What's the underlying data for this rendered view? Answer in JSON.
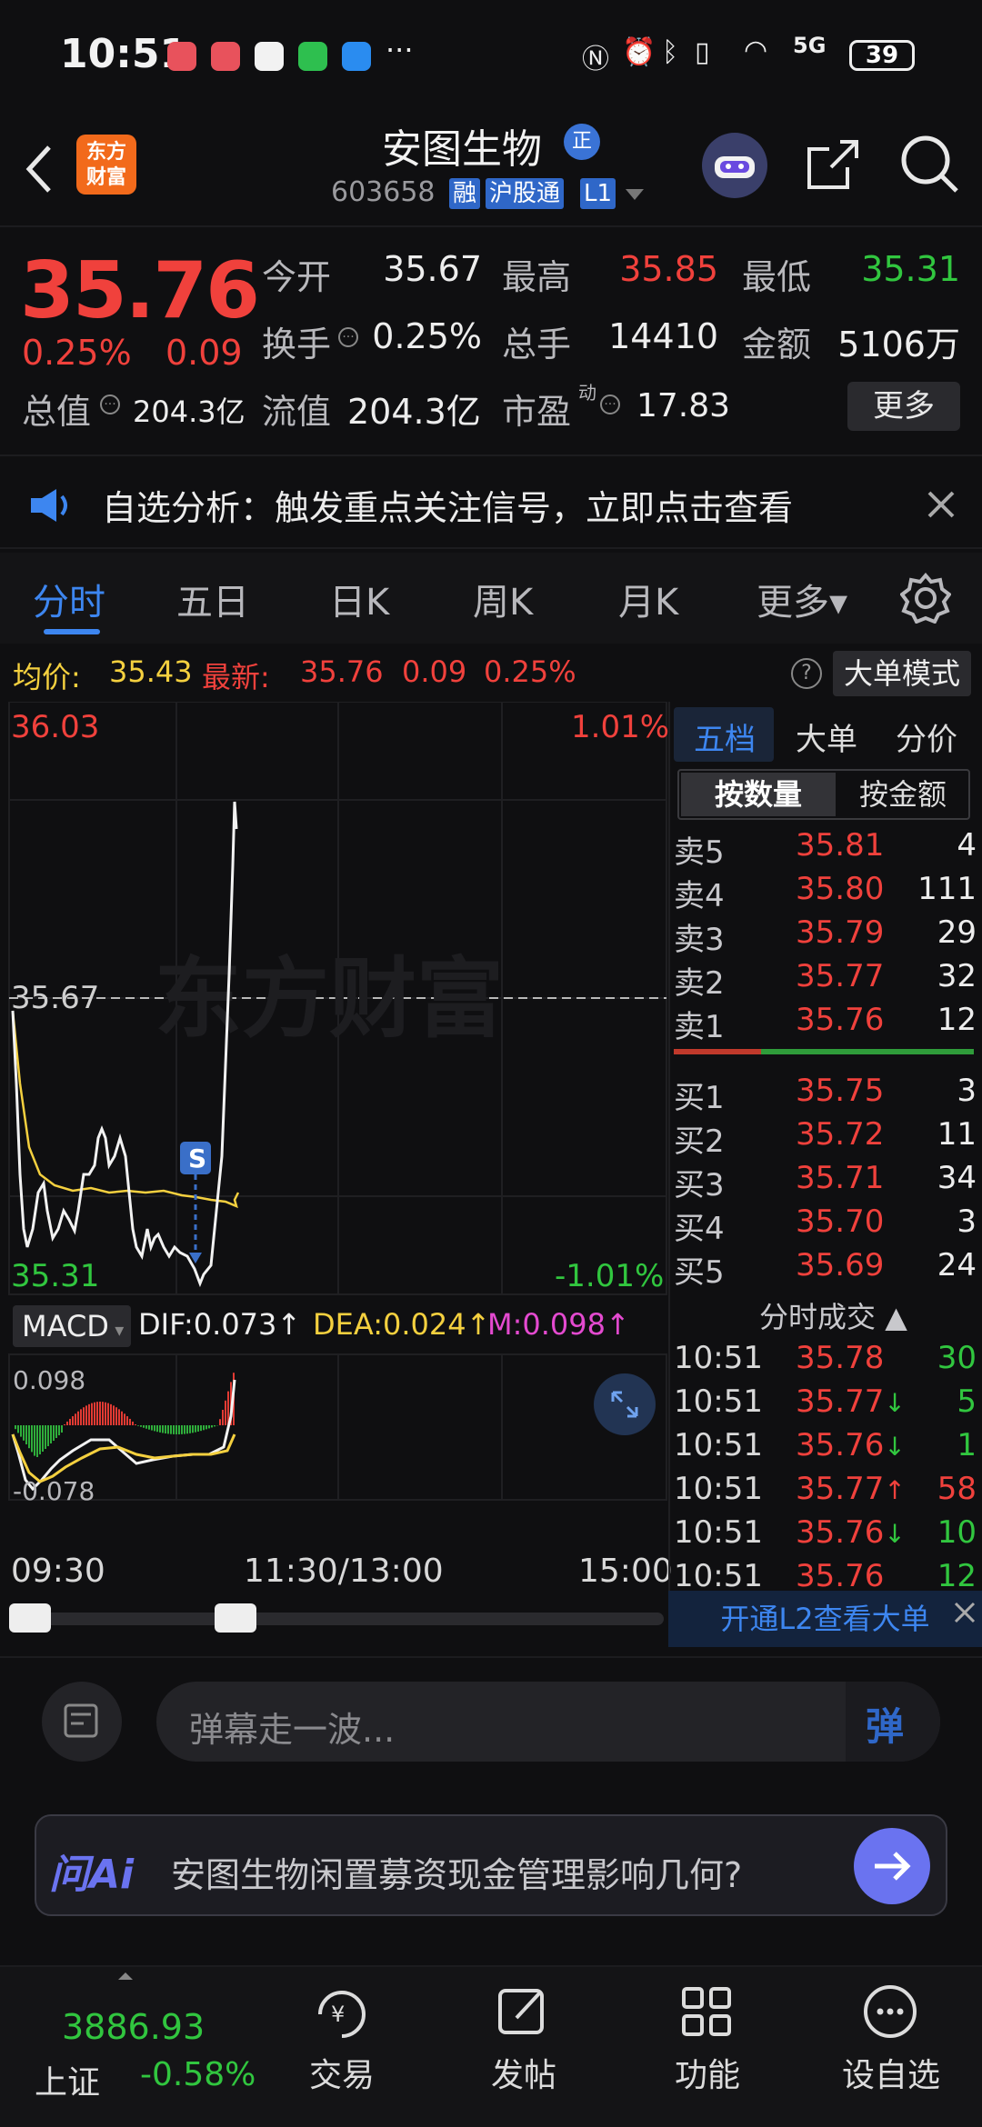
{
  "status_bar": {
    "time": "10:51",
    "network": "5G",
    "battery": "39"
  },
  "header": {
    "back_icon": "chevron-left-icon",
    "logo_text_line1": "东方",
    "logo_text_line2": "财富",
    "title": "安图生物",
    "title_badge": "正",
    "code": "603658",
    "tags": [
      "融",
      "沪股通",
      "L1"
    ],
    "icons": [
      "robot-avatar-icon",
      "share-icon",
      "search-icon"
    ]
  },
  "quote": {
    "price": "35.76",
    "change_pct": "0.25%",
    "change_amt": "0.09",
    "stats": [
      {
        "label": "今开",
        "value": "35.67",
        "color": "#ededed"
      },
      {
        "label": "最高",
        "value": "35.85",
        "color": "#f0413c"
      },
      {
        "label": "最低",
        "value": "35.31",
        "color": "#31c63f"
      },
      {
        "label": "换手",
        "value": "0.25%",
        "color": "#ededed"
      },
      {
        "label": "总手",
        "value": "14410",
        "color": "#ededed"
      },
      {
        "label": "金额",
        "value": "5106万",
        "color": "#ededed"
      },
      {
        "label": "总值",
        "value": "204.3亿",
        "color": "#ededed"
      },
      {
        "label": "流值",
        "value": "204.3亿",
        "color": "#ededed"
      },
      {
        "label": "市盈",
        "value": "17.83",
        "color": "#ededed"
      }
    ],
    "pe_superscript": "动",
    "more_label": "更多"
  },
  "banner": {
    "text": "自选分析：触发重点关注信号，立即点击查看"
  },
  "tabs": [
    "分时",
    "五日",
    "日K",
    "周K",
    "月K",
    "更多▾"
  ],
  "info_row": {
    "avg_label": "均价:",
    "avg_value": "35.43",
    "latest_label": "最新:",
    "latest_value": "35.76",
    "latest_change": "0.09",
    "latest_pct": "0.25%",
    "mode_label": "大单模式"
  },
  "chart_labels": {
    "high": "36.03",
    "high_pct": "1.01%",
    "mid": "35.67",
    "low": "35.31",
    "low_pct": "-1.01%",
    "watermark": "东方财富",
    "signal": "S"
  },
  "macd": {
    "name": "MACD",
    "dif": "DIF:0.073",
    "dea": "DEA:0.024",
    "m": "M:0.098",
    "top": "0.098",
    "bottom": "-0.078"
  },
  "time_axis": [
    "09:30",
    "11:30/13:00",
    "15:00"
  ],
  "book": {
    "tabs": [
      "五档",
      "大单",
      "分价"
    ],
    "toggle": [
      "按数量",
      "按金额"
    ],
    "asks": [
      {
        "label": "卖5",
        "price": "35.81",
        "vol": "4"
      },
      {
        "label": "卖4",
        "price": "35.80",
        "vol": "111"
      },
      {
        "label": "卖3",
        "price": "35.79",
        "vol": "29"
      },
      {
        "label": "卖2",
        "price": "35.77",
        "vol": "32"
      },
      {
        "label": "卖1",
        "price": "35.76",
        "vol": "12"
      }
    ],
    "bids": [
      {
        "label": "买1",
        "price": "35.75",
        "vol": "3"
      },
      {
        "label": "买2",
        "price": "35.72",
        "vol": "11"
      },
      {
        "label": "买3",
        "price": "35.71",
        "vol": "34"
      },
      {
        "label": "买4",
        "price": "35.70",
        "vol": "3"
      },
      {
        "label": "买5",
        "price": "35.69",
        "vol": "24"
      }
    ],
    "ticks_title": "分时成交",
    "ticks": [
      {
        "time": "10:51",
        "price": "35.78",
        "vol": "30",
        "dir": "",
        "vcolor": "#31c63f"
      },
      {
        "time": "10:51",
        "price": "35.77",
        "vol": "5",
        "dir": "↓",
        "vcolor": "#31c63f"
      },
      {
        "time": "10:51",
        "price": "35.76",
        "vol": "1",
        "dir": "↓",
        "vcolor": "#31c63f"
      },
      {
        "time": "10:51",
        "price": "35.77",
        "vol": "58",
        "dir": "↑",
        "vcolor": "#f0413c"
      },
      {
        "time": "10:51",
        "price": "35.76",
        "vol": "10",
        "dir": "↓",
        "vcolor": "#31c63f"
      },
      {
        "time": "10:51",
        "price": "35.76",
        "vol": "12",
        "dir": "",
        "vcolor": "#31c63f"
      }
    ],
    "l2_banner": "开通L2查看大单"
  },
  "danmu": {
    "placeholder": "弹幕走一波...",
    "send_label": "弹"
  },
  "ai": {
    "brand": "问Ai",
    "question": "安图生物闲置募资现金管理影响几何?"
  },
  "bottom_nav": {
    "index_value": "3886.93",
    "index_name": "上证",
    "index_pct": "-0.58%",
    "items": [
      "交易",
      "发帖",
      "功能",
      "设自选"
    ]
  }
}
